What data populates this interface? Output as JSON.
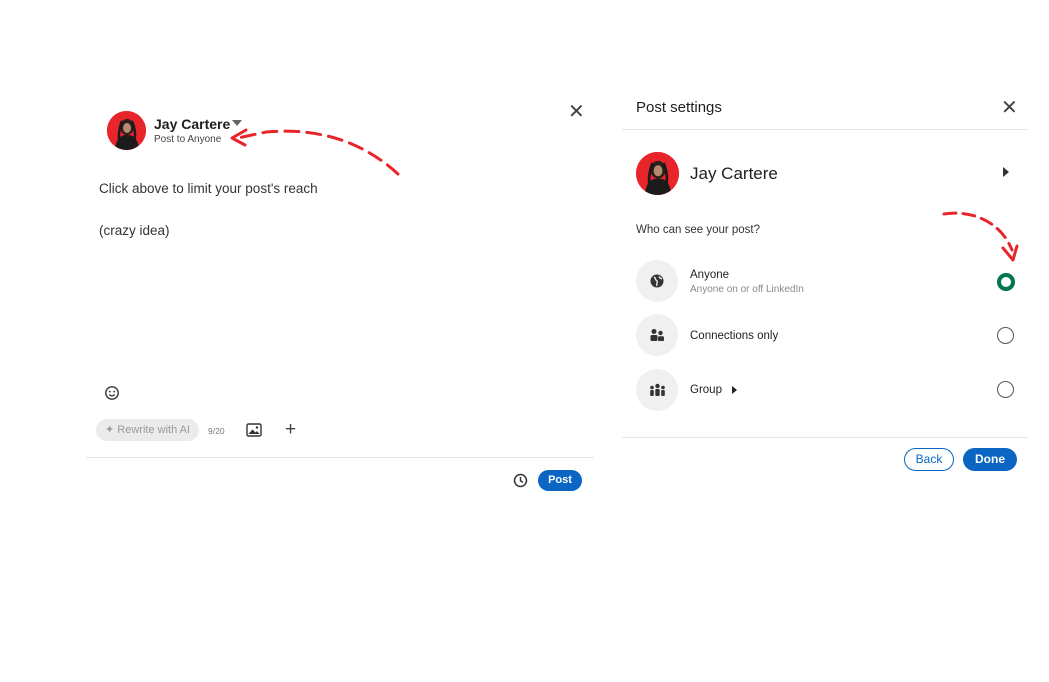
{
  "composer": {
    "author_name": "Jay Cartere",
    "audience_label": "Post to Anyone",
    "body_lines": [
      "Click above to limit your post's reach",
      "(crazy idea)"
    ],
    "rewrite_label": "Rewrite with AI",
    "counter": "9/20",
    "post_label": "Post",
    "icons": [
      "emoji-icon",
      "image-icon",
      "plus-icon",
      "clock-icon",
      "close-icon"
    ]
  },
  "settings": {
    "title": "Post settings",
    "author_name": "Jay Cartere",
    "question": "Who can see your post?",
    "options": [
      {
        "label": "Anyone",
        "sub": "Anyone on or off LinkedIn",
        "icon": "globe-icon",
        "selected": true
      },
      {
        "label": "Connections only",
        "sub": "",
        "icon": "people-icon",
        "selected": false
      },
      {
        "label": "Group",
        "sub": "",
        "icon": "group-icon",
        "selected": false
      }
    ],
    "back_label": "Back",
    "done_label": "Done"
  },
  "colors": {
    "accent": "#0a66c2",
    "selected_radio": "#01754f",
    "annotation_arrow": "#e8252b",
    "avatar_bg": "#e8252b"
  }
}
